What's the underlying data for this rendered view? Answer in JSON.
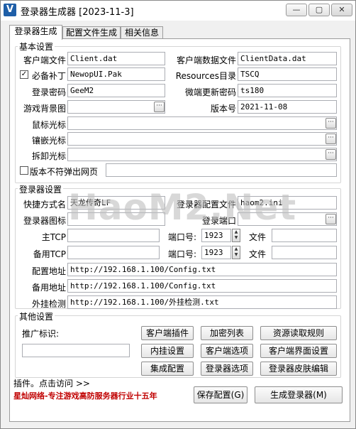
{
  "window": {
    "title": "登录器生成器 [2023-11-3]",
    "app_icon_letter": "V",
    "min_glyph": "—",
    "max_glyph": "▢",
    "close_glyph": "✕"
  },
  "tabs": [
    {
      "label": "登录器生成"
    },
    {
      "label": "配置文件生成"
    },
    {
      "label": "相关信息"
    }
  ],
  "basic": {
    "title": "基本设置",
    "client_file_label": "客户端文件",
    "client_file": "Client.dat",
    "client_data_label": "客户端数据文件",
    "client_data": "ClientData.dat",
    "patch_label": "必备补丁",
    "patch_checked": "✓",
    "patch": "NewopUI.Pak",
    "resources_label": "Resources目录",
    "resources": "TSCQ",
    "password_label": "登录密码",
    "password": "GeeM2",
    "micro_pw_label": "微端更新密码",
    "micro_pw": "ts180",
    "bg_label": "游戏背景图",
    "bg": "",
    "version_label": "版本号",
    "version": "2021-11-08",
    "cursor_label": "鼠标光标",
    "cursor": "",
    "inlay_label": "镶嵌光标",
    "inlay": "",
    "remove_label": "拆卸光标",
    "remove": "",
    "popup_label": "版本不符弹出网页",
    "popup": "",
    "browse_glyph": "···"
  },
  "launcher": {
    "title": "登录器设置",
    "shortcut_label": "快捷方式名",
    "shortcut": "天龙传奇LF",
    "config_file_label": "登录器配置文件",
    "config_file": "haom2.ini",
    "icon_label": "登录器图标",
    "icon": "",
    "port_label_upper": "登录端口",
    "port_upper": "",
    "main_tcp_label": "主TCP",
    "main_tcp": "",
    "port1_label": "端口号:",
    "port1": "1923",
    "file1_label": "文件",
    "file1": "",
    "backup_tcp_label": "备用TCP",
    "backup_tcp": "",
    "port2_label": "端口号:",
    "port2": "1923",
    "file2_label": "文件",
    "file2": "",
    "config_addr_label": "配置地址",
    "config_addr": "http://192.168.1.100/Config.txt",
    "backup_addr_label": "备用地址",
    "backup_addr": "http://192.168.1.100/Config.txt",
    "plugin_check_label": "外挂检测",
    "plugin_check": "http://192.168.1.100/外挂检测.txt",
    "spin_up": "▲",
    "spin_down": "▼"
  },
  "other": {
    "title": "其他设置",
    "promo_label": "推广标识:",
    "promo": "",
    "buttons": [
      "客户端插件",
      "加密列表",
      "资源读取规则",
      "内挂设置",
      "客户端选项",
      "客户端界面设置",
      "集成配置",
      "登录器选项",
      "登录器皮肤编辑"
    ]
  },
  "footer": {
    "plugin_link": "插件。点击访问 >>",
    "slogan": "星灿网络-专注游戏高防服务器行业十五年",
    "save_button": "保存配置(G)",
    "generate_button": "生成登录器(M)"
  },
  "watermark": "HaoM2.Net"
}
